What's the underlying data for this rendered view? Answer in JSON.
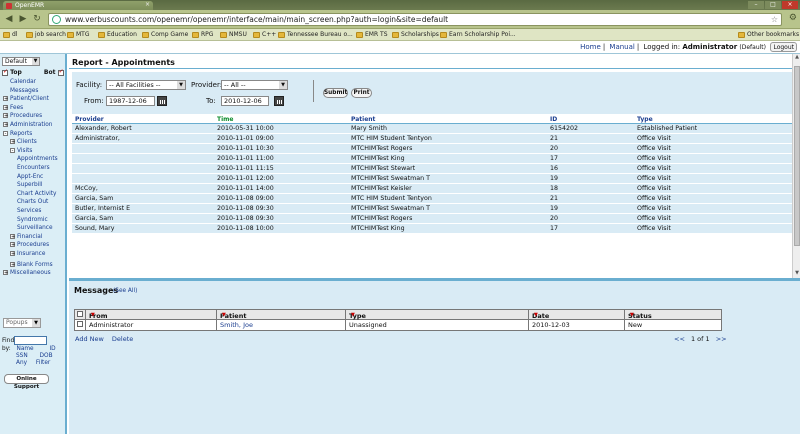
{
  "browser": {
    "tab_title": "OpenEMR",
    "url": "www.verbuscounts.com/openemr/openemr/interface/main/main_screen.php?auth=login&site=default",
    "bookmarks": [
      "dl",
      "job search",
      "MTG",
      "Education",
      "Comp Game",
      "RPG",
      "NMSU",
      "C++",
      "Tennessee Bureau o...",
      "EMR TS",
      "Scholarships",
      "Earn Scholarship Poi..."
    ],
    "other_bookmarks": "Other bookmarks"
  },
  "appbar": {
    "home": "Home",
    "manual": "Manual",
    "logged_in": "Logged in:",
    "user": "Administrator",
    "site": "(Default)",
    "logout": "Logout"
  },
  "leftnav": {
    "default_select": "Default",
    "top_label": "Top",
    "bot_label": "Bot",
    "items": [
      {
        "label": "Calendar",
        "indent": 1
      },
      {
        "label": "Messages",
        "indent": 1
      },
      {
        "label": "Patient/Client",
        "indent": 0,
        "expander": "+"
      },
      {
        "label": "Fees",
        "indent": 0,
        "expander": "+"
      },
      {
        "label": "Procedures",
        "indent": 0,
        "expander": "+"
      },
      {
        "label": "Administration",
        "indent": 0,
        "expander": "+"
      },
      {
        "label": "Reports",
        "indent": 0,
        "expander": "-"
      },
      {
        "label": "Clients",
        "indent": 1,
        "expander": "+"
      },
      {
        "label": "Visits",
        "indent": 1,
        "expander": "-"
      },
      {
        "label": "Appointments",
        "indent": 2
      },
      {
        "label": "Encounters",
        "indent": 2
      },
      {
        "label": "Appt-Enc",
        "indent": 2
      },
      {
        "label": "Superbill",
        "indent": 2
      },
      {
        "label": "Chart Activity",
        "indent": 2
      },
      {
        "label": "Charts Out",
        "indent": 2
      },
      {
        "label": "Services",
        "indent": 2
      },
      {
        "label": "Syndromic",
        "indent": 2
      },
      {
        "label": "Surveillance",
        "indent": 2
      },
      {
        "label": "Financial",
        "indent": 1,
        "expander": "+"
      },
      {
        "label": "Procedures",
        "indent": 1,
        "expander": "+"
      },
      {
        "label": "Insurance",
        "indent": 1,
        "expander": "+"
      },
      {
        "label": "Blank Forms",
        "indent": 1,
        "expander": "+"
      },
      {
        "label": "Miscellaneous",
        "indent": 0,
        "expander": "+"
      }
    ],
    "popups": "Popups",
    "find_label": "Find:",
    "by_label": "by:",
    "find_by": [
      "Name",
      "ID",
      "SSN",
      "DOB",
      "Any",
      "Filter"
    ],
    "online_support": "Online Support"
  },
  "report": {
    "title": "Report - Appointments",
    "facility_label": "Facility:",
    "facility_value": "-- All Facilities --",
    "provider_label": "Provider:",
    "provider_value": "-- All --",
    "from_label": "From:",
    "from_value": "1987-12-06",
    "to_label": "To:",
    "to_value": "2010-12-06",
    "submit": "Submit",
    "print": "Print",
    "columns": [
      "Provider",
      "Time",
      "Patient",
      "ID",
      "Type"
    ],
    "rows": [
      [
        "Alexander, Robert",
        "2010-05-31 10:00",
        "Mary Smith",
        "6154202",
        "Established Patient"
      ],
      [
        "Administrator,",
        "2010-11-01 09:00",
        "MTC HIM Student Tentyon",
        "21",
        "Office Visit"
      ],
      [
        "",
        "2010-11-01 10:30",
        "MTCHIMTest Rogers",
        "20",
        "Office Visit"
      ],
      [
        "",
        "2010-11-01 11:00",
        "MTCHIMTest King",
        "17",
        "Office Visit"
      ],
      [
        "",
        "2010-11-01 11:15",
        "MTCHIMTest Stewart",
        "16",
        "Office Visit"
      ],
      [
        "",
        "2010-11-01 12:00",
        "MTCHIMTest Sweatman T",
        "19",
        "Office Visit"
      ],
      [
        "McCoy,",
        "2010-11-01 14:00",
        "MTCHIMTest Keisler",
        "18",
        "Office Visit"
      ],
      [
        "Garcia, Sam",
        "2010-11-08 09:00",
        "MTC HIM Student Tentyon",
        "21",
        "Office Visit"
      ],
      [
        "Butler, Internist E",
        "2010-11-08 09:30",
        "MTCHIMTest Sweatman T",
        "19",
        "Office Visit"
      ],
      [
        "Garcia, Sam",
        "2010-11-08 09:30",
        "MTCHIMTest Rogers",
        "20",
        "Office Visit"
      ],
      [
        "Sound, Mary",
        "2010-11-08 10:00",
        "MTCHIMTest King",
        "17",
        "Office Visit"
      ]
    ]
  },
  "messages": {
    "title": "Messages",
    "see_all": "(See All)",
    "columns": [
      "From",
      "Patient",
      "Type",
      "Date",
      "Status"
    ],
    "rows": [
      [
        "Administrator",
        "Smith, Joe",
        "Unassigned",
        "2010-12-03",
        "New"
      ]
    ],
    "add_new": "Add New",
    "delete": "Delete",
    "pager_prev": "<<",
    "pager_text": "1 of 1",
    "pager_next": ">>"
  }
}
